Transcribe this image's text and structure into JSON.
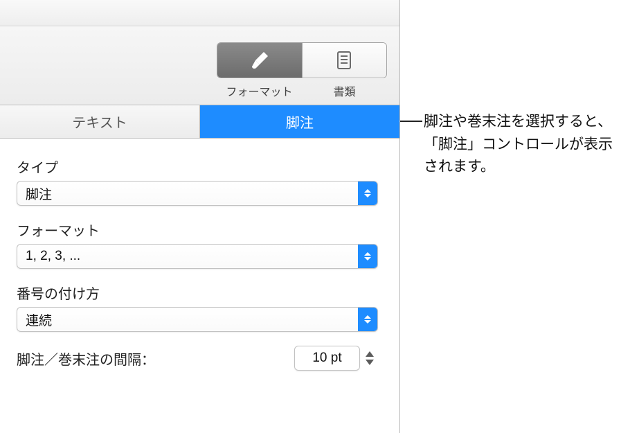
{
  "toolbar": {
    "format_label": "フォーマット",
    "document_label": "書類"
  },
  "tabs": {
    "text": "テキスト",
    "footnotes": "脚注"
  },
  "fields": {
    "type_label": "タイプ",
    "type_value": "脚注",
    "format_label": "フォーマット",
    "format_value": "1, 2, 3, ...",
    "numbering_label": "番号の付け方",
    "numbering_value": "連続",
    "spacing_label": "脚注／巻末注の間隔：",
    "spacing_value": "10 pt"
  },
  "callout": "脚注や巻末注を選択すると、「脚注」コントロールが表示されます。"
}
